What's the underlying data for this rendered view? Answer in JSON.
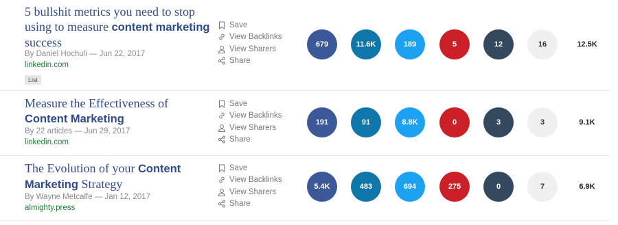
{
  "colors": {
    "facebook": "#3b5998",
    "linkedin": "#0e76a8",
    "twitter": "#1da1f2",
    "pinterest": "#cb2027",
    "reddit": "#34495e",
    "evergreen": "#f0f0f0"
  },
  "action_labels": {
    "save": "Save",
    "backlinks": "View Backlinks",
    "sharers": "View Sharers",
    "share": "Share"
  },
  "results": [
    {
      "title_pre": "5 bullshit metrics you need to stop using to measure ",
      "title_bold": "content marketing",
      "title_post": " success",
      "byline": "By Daniel Hochuli — Jun 22, 2017",
      "domain": "linkedin.com",
      "tag": "List",
      "stats": {
        "facebook": "679",
        "linkedin": "11.6K",
        "twitter": "189",
        "pinterest": "5",
        "reddit": "12",
        "evergreen": "16",
        "total": "12.5K"
      }
    },
    {
      "title_pre": "Measure the Effectiveness of ",
      "title_bold": "Content Marketing",
      "title_post": "",
      "byline": "By 22 articles — Jun 29, 2017",
      "domain": "linkedin.com",
      "stats": {
        "facebook": "191",
        "linkedin": "91",
        "twitter": "8.8K",
        "pinterest": "0",
        "reddit": "3",
        "evergreen": "3",
        "total": "9.1K"
      }
    },
    {
      "title_pre": "The Evolution of your ",
      "title_bold": "Content Marketing",
      "title_post": " Strategy",
      "byline": "By Wayne Metcalfe — Jan 12, 2017",
      "domain": "almighty.press",
      "stats": {
        "facebook": "5.4K",
        "linkedin": "483",
        "twitter": "694",
        "pinterest": "275",
        "reddit": "0",
        "evergreen": "7",
        "total": "6.9K"
      }
    }
  ]
}
